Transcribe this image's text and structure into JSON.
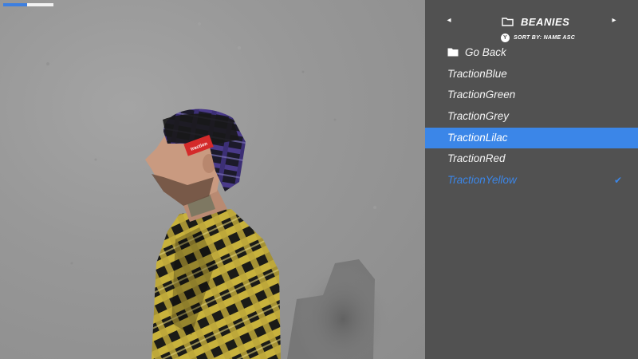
{
  "progress": {
    "fraction": 0.48
  },
  "panel": {
    "title": "BEANIES",
    "sort_button": "Y",
    "sort_label": "SORT BY: NAME ASC",
    "prev_arrow": "◂",
    "next_arrow": "▸",
    "items": [
      {
        "label": "Go Back",
        "type": "back"
      },
      {
        "label": "TractionBlue"
      },
      {
        "label": "TractionGreen"
      },
      {
        "label": "TractionGrey"
      },
      {
        "label": "TractionLilac",
        "state": "selected"
      },
      {
        "label": "TractionRed"
      },
      {
        "label": "TractionYellow",
        "state": "equipped"
      }
    ],
    "check_mark": "✔"
  },
  "colors": {
    "accent": "#3b86e8",
    "panel_bg": "#515151",
    "wall": "#989898"
  },
  "beanie_tag": "traction"
}
